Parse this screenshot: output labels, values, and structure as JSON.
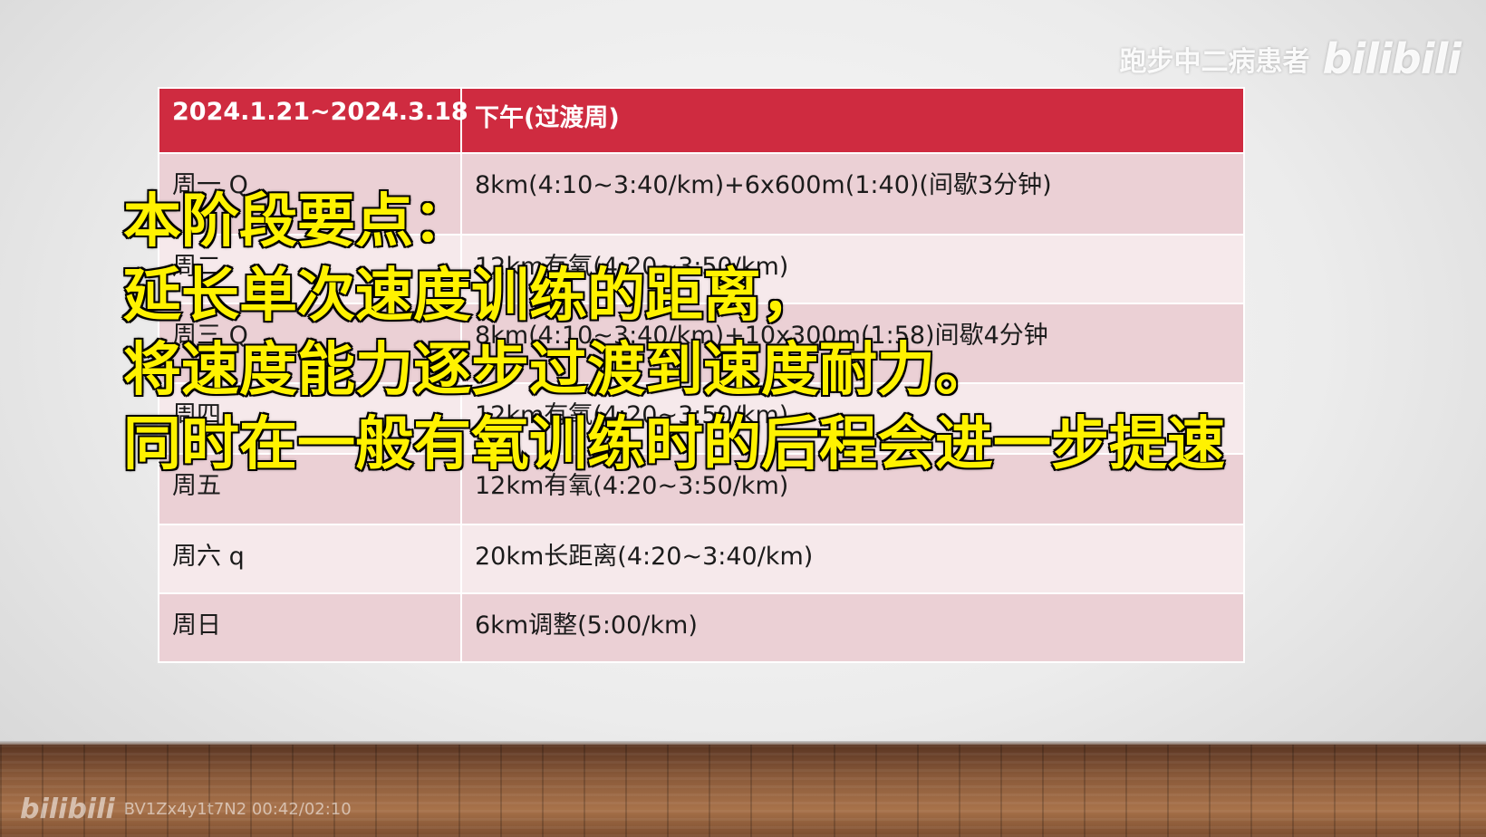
{
  "table": {
    "header": {
      "date_range": "2024.1.21~2024.3.18",
      "session": "下午(过渡周)"
    },
    "rows": [
      {
        "day": "周一 Q",
        "plan": "8km(4:10~3:40/km)+6x600m(1:40)(间歇3分钟)"
      },
      {
        "day": "周二",
        "plan": "12km有氧(4:20~3:50/km)"
      },
      {
        "day": "周三 Q",
        "plan": "8km(4:10~3:40/km)+10x300m(1:58)间歇4分钟"
      },
      {
        "day": "周四",
        "plan": "12km有氧(4:20~3:50/km)"
      },
      {
        "day": "周五",
        "plan": "12km有氧(4:20~3:50/km)"
      },
      {
        "day": "周六 q",
        "plan": "20km长距离(4:20~3:40/km)"
      },
      {
        "day": "周日",
        "plan": "6km调整(5:00/km)"
      }
    ]
  },
  "overlay": {
    "line1": "本阶段要点：",
    "line2": "延长单次速度训练的距离，",
    "line3": "将速度能力逐步过渡到速度耐力。",
    "line4": "同时在一般有氧训练时的后程会进一步提速"
  },
  "watermark": {
    "author": "跑步中二病患者",
    "logo": "bilibili"
  },
  "footer": {
    "logo": "bilibili",
    "video_id": "BV1Zx4y1t7N2 00:42/02:10"
  },
  "colors": {
    "header_red": "#cf2b40",
    "row_dark": "#ebd0d5",
    "row_light": "#f6e9eb",
    "overlay_yellow": "#fff200"
  }
}
